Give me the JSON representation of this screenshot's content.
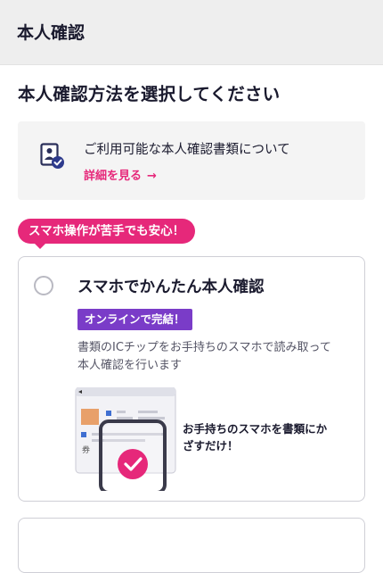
{
  "header": {
    "title": "本人確認"
  },
  "page": {
    "heading": "本人確認方法を選択してください"
  },
  "info": {
    "text": "ご利用可能な本人確認書類について",
    "link_label": "詳細を見る",
    "link_arrow": "→",
    "icon": "id-document-check-icon"
  },
  "promo": {
    "label": "スマホ操作が苦手でも安心！"
  },
  "option": {
    "title": "スマホでかんたん本人確認",
    "badge": "オンラインで完結！",
    "description_line1": "書類のICチップをお手持ちのスマホで読み取って",
    "description_line2": "本人確認を行います",
    "illustration_caption_line1": "お手持ちのスマホを書類にか",
    "illustration_caption_line2": "ざすだけ！",
    "selected": false
  },
  "colors": {
    "accent": "#e6287a",
    "badge_purple": "#7a3cc8",
    "text": "#1a1a2e",
    "header_bg": "#eeeeee"
  }
}
